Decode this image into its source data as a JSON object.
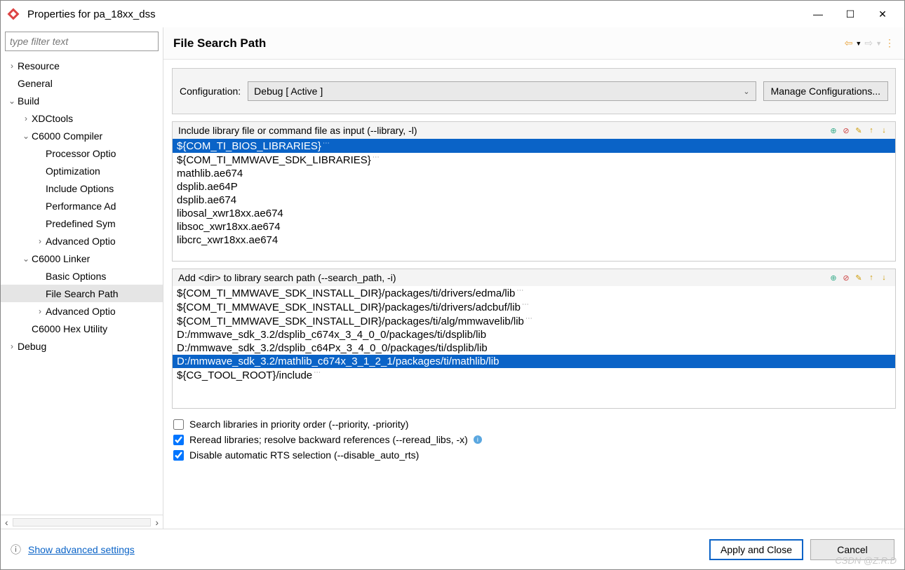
{
  "window": {
    "title": "Properties for pa_18xx_dss"
  },
  "sidebar": {
    "filter_placeholder": "type filter text",
    "tree": [
      {
        "label": "Resource",
        "depth": 0,
        "expander": "›"
      },
      {
        "label": "General",
        "depth": 0,
        "expander": ""
      },
      {
        "label": "Build",
        "depth": 0,
        "expander": "⌄"
      },
      {
        "label": "XDCtools",
        "depth": 1,
        "expander": "›"
      },
      {
        "label": "C6000 Compiler",
        "depth": 1,
        "expander": "⌄"
      },
      {
        "label": "Processor Optio",
        "depth": 2,
        "expander": ""
      },
      {
        "label": "Optimization",
        "depth": 2,
        "expander": ""
      },
      {
        "label": "Include Options",
        "depth": 2,
        "expander": ""
      },
      {
        "label": "Performance Ad",
        "depth": 2,
        "expander": ""
      },
      {
        "label": "Predefined Sym",
        "depth": 2,
        "expander": ""
      },
      {
        "label": "Advanced Optio",
        "depth": 2,
        "expander": "›"
      },
      {
        "label": "C6000 Linker",
        "depth": 1,
        "expander": "⌄"
      },
      {
        "label": "Basic Options",
        "depth": 2,
        "expander": ""
      },
      {
        "label": "File Search Path",
        "depth": 2,
        "expander": "",
        "selected": true
      },
      {
        "label": "Advanced Optio",
        "depth": 2,
        "expander": "›"
      },
      {
        "label": "C6000 Hex Utility",
        "depth": 1,
        "expander": ""
      },
      {
        "label": "Debug",
        "depth": 0,
        "expander": "›"
      }
    ]
  },
  "page": {
    "title": "File Search Path",
    "config_label": "Configuration:",
    "config_value": "Debug  [ Active ]",
    "manage_btn": "Manage Configurations...",
    "lib_section": {
      "header": "Include library file or command file as input (--library, -l)",
      "items": [
        {
          "text": "${COM_TI_BIOS_LIBRARIES}",
          "macro": true,
          "selected": true
        },
        {
          "text": "${COM_TI_MMWAVE_SDK_LIBRARIES}",
          "macro": true
        },
        {
          "text": "mathlib.ae674"
        },
        {
          "text": "dsplib.ae64P"
        },
        {
          "text": "dsplib.ae674"
        },
        {
          "text": "libosal_xwr18xx.ae674"
        },
        {
          "text": "libsoc_xwr18xx.ae674"
        },
        {
          "text": "libcrc_xwr18xx.ae674"
        }
      ]
    },
    "path_section": {
      "header": "Add <dir> to library search path (--search_path, -i)",
      "items": [
        {
          "text": "${COM_TI_MMWAVE_SDK_INSTALL_DIR}/packages/ti/drivers/edma/lib",
          "macro": true
        },
        {
          "text": "${COM_TI_MMWAVE_SDK_INSTALL_DIR}/packages/ti/drivers/adcbuf/lib",
          "macro": true
        },
        {
          "text": "${COM_TI_MMWAVE_SDK_INSTALL_DIR}/packages/ti/alg/mmwavelib/lib",
          "macro": true
        },
        {
          "text": "D:/mmwave_sdk_3.2/dsplib_c674x_3_4_0_0/packages/ti/dsplib/lib"
        },
        {
          "text": "D:/mmwave_sdk_3.2/dsplib_c64Px_3_4_0_0/packages/ti/dsplib/lib"
        },
        {
          "text": "D:/mmwave_sdk_3.2/mathlib_c674x_3_1_2_1/packages/ti/mathlib/lib",
          "selected": true
        },
        {
          "text": "${CG_TOOL_ROOT}/include",
          "macro": true
        }
      ]
    },
    "checks": [
      {
        "label": "Search libraries in priority order (--priority, -priority)",
        "checked": false
      },
      {
        "label": "Reread libraries; resolve backward references (--reread_libs, -x)",
        "checked": true,
        "info": true
      },
      {
        "label": "Disable automatic RTS selection (--disable_auto_rts)",
        "checked": true
      }
    ]
  },
  "footer": {
    "advanced": "Show advanced settings",
    "apply": "Apply and Close",
    "cancel": "Cancel"
  },
  "watermark": "CSDN @Z.R.D"
}
